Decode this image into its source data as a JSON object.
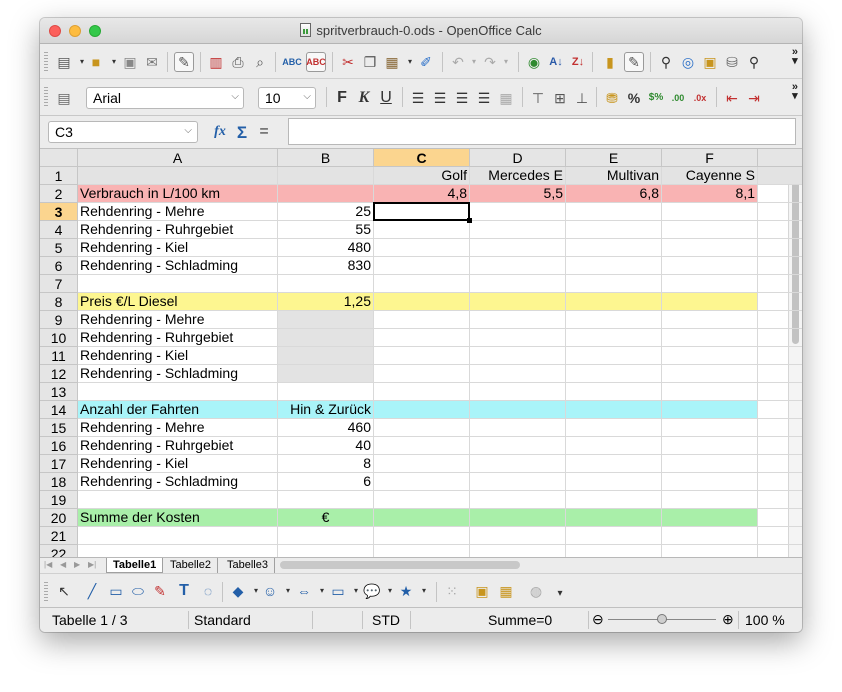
{
  "window": {
    "title": "spritverbrauch-0.ods - OpenOffice Calc"
  },
  "toolbar": {
    "font_name": "Arial",
    "font_size": "10",
    "bold_label": "F",
    "italic_label": "K",
    "underline_label": "U",
    "percent_label": "%"
  },
  "formula_bar": {
    "cell_ref": "C3",
    "function_symbol": "fx",
    "sum_symbol": "Σ",
    "equals_symbol": "=",
    "content": ""
  },
  "sheet": {
    "columns": [
      "A",
      "B",
      "C",
      "D",
      "E",
      "F"
    ],
    "selected_column": "C",
    "selected_row": "3",
    "rows": [
      {
        "n": "1",
        "cells": [
          "",
          "",
          "Golf",
          "Mercedes E",
          "Multivan",
          "Cayenne S"
        ],
        "fill": ""
      },
      {
        "n": "2",
        "cells": [
          "Verbrauch in L/100 km",
          "",
          "4,8",
          "5,5",
          "6,8",
          "8,1"
        ],
        "fill": "#f9b3b3"
      },
      {
        "n": "3",
        "cells": [
          "Rehdenring - Mehre",
          "25",
          "",
          "",
          "",
          ""
        ],
        "fill": ""
      },
      {
        "n": "4",
        "cells": [
          "Rehdenring - Ruhrgebiet",
          "55",
          "",
          "",
          "",
          ""
        ],
        "fill": ""
      },
      {
        "n": "5",
        "cells": [
          "Rehdenring - Kiel",
          "480",
          "",
          "",
          "",
          ""
        ],
        "fill": ""
      },
      {
        "n": "6",
        "cells": [
          "Rehdenring - Schladming",
          "830",
          "",
          "",
          "",
          ""
        ],
        "fill": ""
      },
      {
        "n": "7",
        "cells": [
          "",
          "",
          "",
          "",
          "",
          ""
        ],
        "fill": ""
      },
      {
        "n": "8",
        "cells": [
          "Preis €/L Diesel",
          "1,25",
          "",
          "",
          "",
          ""
        ],
        "fill": "#fdf690"
      },
      {
        "n": "9",
        "cells": [
          "Rehdenring - Mehre",
          "",
          "",
          "",
          "",
          ""
        ],
        "fill": "",
        "b_fill": "#e3e3e3"
      },
      {
        "n": "10",
        "cells": [
          "Rehdenring - Ruhrgebiet",
          "",
          "",
          "",
          "",
          ""
        ],
        "fill": "",
        "b_fill": "#e3e3e3"
      },
      {
        "n": "11",
        "cells": [
          "Rehdenring - Kiel",
          "",
          "",
          "",
          "",
          ""
        ],
        "fill": "",
        "b_fill": "#e3e3e3"
      },
      {
        "n": "12",
        "cells": [
          "Rehdenring - Schladming",
          "",
          "",
          "",
          "",
          ""
        ],
        "fill": "",
        "b_fill": "#e3e3e3"
      },
      {
        "n": "13",
        "cells": [
          "",
          "",
          "",
          "",
          "",
          ""
        ],
        "fill": ""
      },
      {
        "n": "14",
        "cells": [
          "Anzahl der Fahrten",
          "Hin & Zurück",
          "",
          "",
          "",
          ""
        ],
        "fill": "#a9f4f9"
      },
      {
        "n": "15",
        "cells": [
          "Rehdenring - Mehre",
          "460",
          "",
          "",
          "",
          ""
        ],
        "fill": ""
      },
      {
        "n": "16",
        "cells": [
          "Rehdenring - Ruhrgebiet",
          "40",
          "",
          "",
          "",
          ""
        ],
        "fill": ""
      },
      {
        "n": "17",
        "cells": [
          "Rehdenring - Kiel",
          "8",
          "",
          "",
          "",
          ""
        ],
        "fill": ""
      },
      {
        "n": "18",
        "cells": [
          "Rehdenring - Schladming",
          "6",
          "",
          "",
          "",
          ""
        ],
        "fill": ""
      },
      {
        "n": "19",
        "cells": [
          "",
          "",
          "",
          "",
          "",
          ""
        ],
        "fill": ""
      },
      {
        "n": "20",
        "cells": [
          "Summe der Kosten",
          "€",
          "",
          "",
          "",
          ""
        ],
        "fill": "#a9efa9",
        "b_align": "center"
      },
      {
        "n": "21",
        "cells": [
          "",
          "",
          "",
          "",
          "",
          ""
        ],
        "fill": ""
      },
      {
        "n": "22",
        "cells": [
          "",
          "",
          "",
          "",
          "",
          ""
        ],
        "fill": ""
      }
    ],
    "row1_fill": "#e3e3e3"
  },
  "tabs": [
    {
      "label": "Tabelle1",
      "active": true
    },
    {
      "label": "Tabelle2",
      "active": false
    },
    {
      "label": "Tabelle3",
      "active": false
    }
  ],
  "status": {
    "sheet": "Tabelle 1 / 3",
    "style": "Standard",
    "mode": "STD",
    "sum": "Summe=0",
    "zoom": "100 %",
    "zoom_minus": "⊖",
    "zoom_plus": "⊕"
  }
}
